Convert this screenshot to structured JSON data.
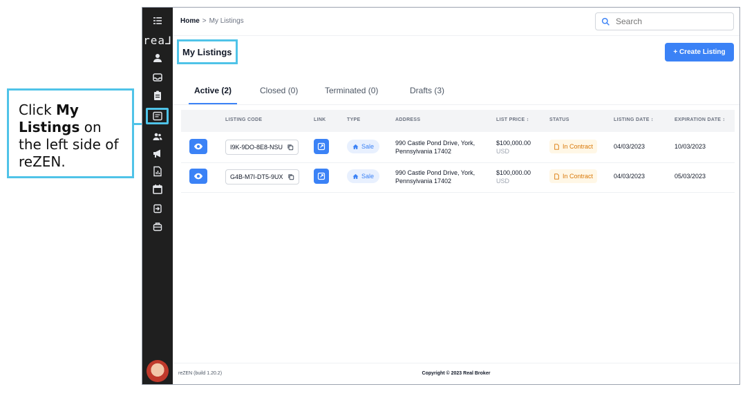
{
  "callout": {
    "prefix": "Click ",
    "bold": "My Listings",
    "suffix": " on the left side of reZEN."
  },
  "sidebar": {
    "logo": "rea⅃"
  },
  "breadcrumb": {
    "home": "Home",
    "separator": ">",
    "current": "My Listings"
  },
  "search": {
    "placeholder": "Search"
  },
  "page": {
    "title": "My Listings",
    "create_label": "+ Create Listing"
  },
  "tabs": [
    {
      "label": "Active (2)"
    },
    {
      "label": "Closed (0)"
    },
    {
      "label": "Terminated (0)"
    },
    {
      "label": "Drafts (3)"
    }
  ],
  "table": {
    "columns": [
      "LISTING CODE",
      "LINK",
      "TYPE",
      "ADDRESS",
      "LIST PRICE ↕",
      "STATUS",
      "LISTING DATE ↕",
      "EXPIRATION DATE ↕"
    ],
    "rows": [
      {
        "code": "I9K-9DO-8E8-NSU",
        "type": "Sale",
        "address": "990 Castle Pond Drive, York, Pennsylvania 17402",
        "price": "$100,000.00",
        "currency": "USD",
        "status": "In Contract",
        "listing_date": "04/03/2023",
        "expiration_date": "10/03/2023"
      },
      {
        "code": "G4B-M7I-DT5-9UX",
        "type": "Sale",
        "address": "990 Castle Pond Drive, York, Pennsylvania 17402",
        "price": "$100,000.00",
        "currency": "USD",
        "status": "In Contract",
        "listing_date": "04/03/2023",
        "expiration_date": "05/03/2023"
      }
    ]
  },
  "footer": {
    "build": "reZEN (build 1.20.2)",
    "copyright": "Copyright © 2023 Real Broker"
  },
  "colors": {
    "accent": "#3b82f6",
    "highlight": "#4fc3e8",
    "sidebar": "#1f1f1f",
    "status": "#d97706"
  }
}
